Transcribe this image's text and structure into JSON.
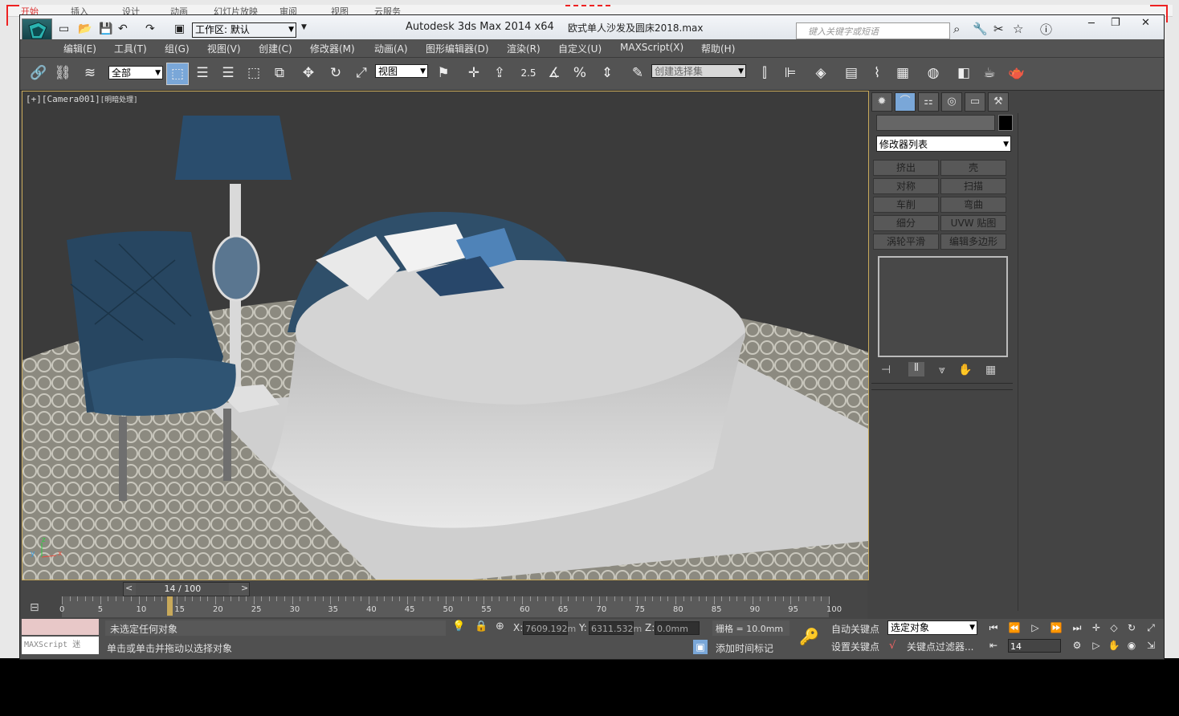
{
  "app": {
    "title": "Autodesk 3ds Max  2014 x64",
    "filename": "欧式单人沙发及圆床2018.max",
    "workspace": "工作区: 默认",
    "search_placeholder": "键入关键字或短语"
  },
  "menubar": [
    "编辑(E)",
    "工具(T)",
    "组(G)",
    "视图(V)",
    "创建(C)",
    "修改器(M)",
    "动画(A)",
    "图形编辑器(D)",
    "渲染(R)",
    "自定义(U)",
    "MAXScript(X)",
    "帮助(H)"
  ],
  "toolbar": {
    "filter": "全部",
    "refcoord": "视图",
    "selset_placeholder": "创建选择集",
    "snap_angle": "2.5"
  },
  "viewport": {
    "label_plus": "[+]",
    "label_camera": "[Camera001]",
    "label_shading": "[明暗处理]",
    "axis_z": "z",
    "axis_x": "x",
    "axis_y": "y"
  },
  "command_panel": {
    "modifier_list": "修改器列表",
    "buttons": [
      "挤出",
      "壳",
      "对称",
      "扫描",
      "车削",
      "弯曲",
      "细分",
      "UVW 贴图",
      "涡轮平滑",
      "编辑多边形"
    ]
  },
  "timeline": {
    "frame_label": "14 / 100",
    "prev": "<",
    "next": ">",
    "ticks": [
      "0",
      "5",
      "10",
      "15",
      "20",
      "25",
      "30",
      "35",
      "40",
      "45",
      "50",
      "55",
      "60",
      "65",
      "70",
      "75",
      "80",
      "85",
      "90",
      "95",
      "100"
    ],
    "current_frame_fraction": 0.14
  },
  "status": {
    "maxscript": "MAXScript 迷",
    "line1": "未选定任何对象",
    "line2": "单击或单击并拖动以选择对象",
    "x_label": "X:",
    "x_value": "7609.192m",
    "y_label": "Y:",
    "y_value": "6311.532m",
    "z_label": "Z:",
    "z_value": "0.0mm",
    "grid": "栅格 = 10.0mm",
    "add_time_tag": "添加时间标记",
    "auto_key": "自动关键点",
    "set_key": "设置关键点",
    "selected_object": "选定对象",
    "key_filters": "关键点过滤器...",
    "current_frame": "14"
  },
  "backdoc_tabs": [
    "开始",
    "插入",
    "设计",
    "动画",
    "幻灯片放映",
    "审阅",
    "视图",
    "云服务"
  ]
}
